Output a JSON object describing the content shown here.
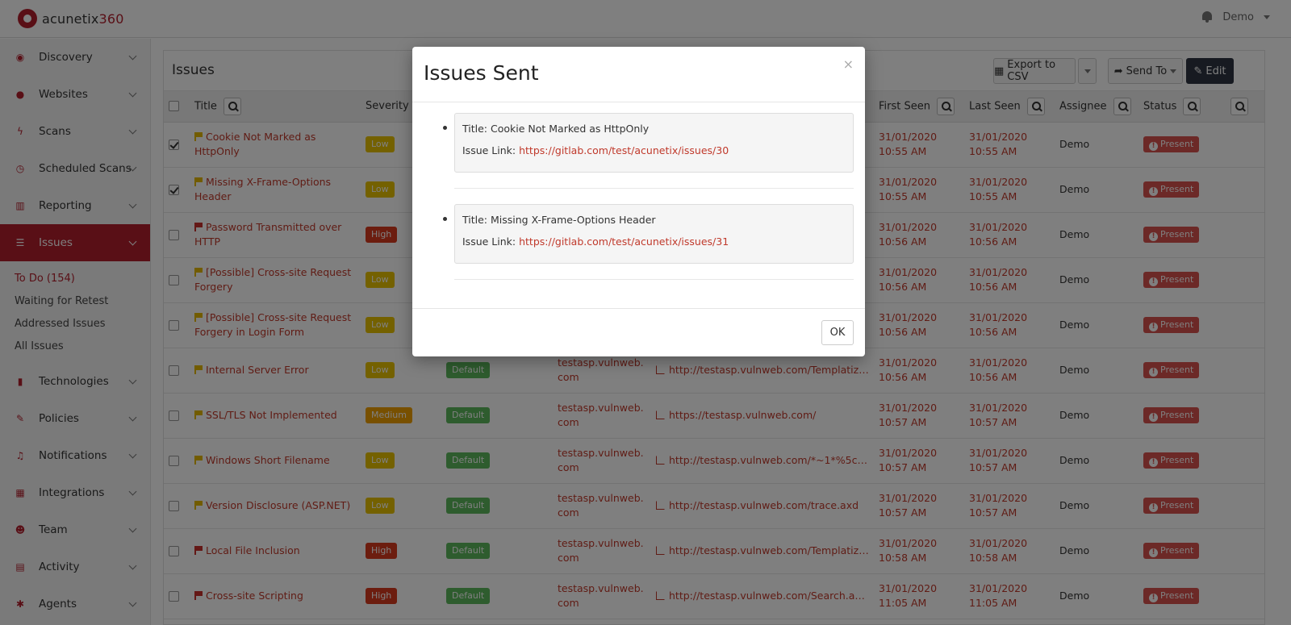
{
  "app": {
    "logo_prefix": "acunetix",
    "logo_suffix": "360",
    "user": "Demo"
  },
  "sidebar": {
    "items": [
      {
        "label": "Discovery",
        "icon": "discovery-icon",
        "glyph": "◉"
      },
      {
        "label": "Websites",
        "icon": "globe-icon",
        "glyph": "●"
      },
      {
        "label": "Scans",
        "icon": "bolt-icon",
        "glyph": "ϟ"
      },
      {
        "label": "Scheduled Scans",
        "icon": "clock-icon",
        "glyph": "◷"
      },
      {
        "label": "Reporting",
        "icon": "bar-chart-icon",
        "glyph": "▥"
      },
      {
        "label": "Issues",
        "icon": "list-icon",
        "glyph": "☰"
      },
      {
        "label": "Technologies",
        "icon": "book-icon",
        "glyph": "▮"
      },
      {
        "label": "Policies",
        "icon": "edit-icon",
        "glyph": "✎"
      },
      {
        "label": "Notifications",
        "icon": "bell-icon",
        "glyph": "♫"
      },
      {
        "label": "Integrations",
        "icon": "puzzle-icon",
        "glyph": "▦"
      },
      {
        "label": "Team",
        "icon": "users-icon",
        "glyph": "☻"
      },
      {
        "label": "Activity",
        "icon": "book-icon",
        "glyph": "▤"
      },
      {
        "label": "Agents",
        "icon": "asterisk-icon",
        "glyph": "✱"
      }
    ],
    "issues_sub": [
      "To Do (154)",
      "Waiting for Retest",
      "Addressed Issues",
      "All Issues"
    ]
  },
  "panel": {
    "title": "Issues",
    "export_label": "Export to CSV",
    "send_to_label": "Send To",
    "edit_label": "Edit"
  },
  "table": {
    "headers": {
      "title": "Title",
      "severity": "Severity",
      "first_seen": "First Seen",
      "last_seen": "Last Seen",
      "assignee": "Assignee",
      "status": "Status"
    },
    "rows": [
      {
        "checked": true,
        "flag": "yellow",
        "title": "Cookie Not Marked as HttpOnly",
        "severity": "Low",
        "sev_class": "low",
        "policy": "",
        "host": "",
        "url": "",
        "first_seen": "31/01/2020 10:55 AM",
        "last_seen": "31/01/2020 10:55 AM",
        "assignee": "Demo",
        "status": "Present"
      },
      {
        "checked": true,
        "flag": "yellow",
        "title": "Missing X-Frame-Options Header",
        "severity": "Low",
        "sev_class": "low",
        "policy": "",
        "host": "",
        "url": "",
        "first_seen": "31/01/2020 10:55 AM",
        "last_seen": "31/01/2020 10:55 AM",
        "assignee": "Demo",
        "status": "Present"
      },
      {
        "checked": false,
        "flag": "red",
        "title": "Password Transmitted over HTTP",
        "severity": "High",
        "sev_class": "high",
        "policy": "",
        "host": "",
        "url": "",
        "first_seen": "31/01/2020 10:56 AM",
        "last_seen": "31/01/2020 10:56 AM",
        "assignee": "Demo",
        "status": "Present"
      },
      {
        "checked": false,
        "flag": "yellow",
        "title": "[Possible] Cross-site Request Forgery",
        "severity": "Low",
        "sev_class": "low",
        "policy": "",
        "host": "",
        "url": "",
        "first_seen": "31/01/2020 10:56 AM",
        "last_seen": "31/01/2020 10:56 AM",
        "assignee": "Demo",
        "status": "Present"
      },
      {
        "checked": false,
        "flag": "yellow",
        "title": "[Possible] Cross-site Request Forgery in Login Form",
        "severity": "Low",
        "sev_class": "low",
        "policy": "",
        "host": "",
        "url": "",
        "first_seen": "31/01/2020 10:56 AM",
        "last_seen": "31/01/2020 10:56 AM",
        "assignee": "Demo",
        "status": "Present"
      },
      {
        "checked": false,
        "flag": "yellow",
        "title": "Internal Server Error",
        "severity": "Low",
        "sev_class": "low",
        "policy": "Default",
        "host": "testasp.vulnweb.com",
        "url": "http://testasp.vulnweb.com/Templatize.asp",
        "first_seen": "31/01/2020 10:56 AM",
        "last_seen": "31/01/2020 10:56 AM",
        "assignee": "Demo",
        "status": "Present"
      },
      {
        "checked": false,
        "flag": "yellow",
        "title": "SSL/TLS Not Implemented",
        "severity": "Medium",
        "sev_class": "medium",
        "policy": "Default",
        "host": "testasp.vulnweb.com",
        "url": "https://testasp.vulnweb.com/",
        "first_seen": "31/01/2020 10:57 AM",
        "last_seen": "31/01/2020 10:57 AM",
        "assignee": "Demo",
        "status": "Present"
      },
      {
        "checked": false,
        "flag": "yellow",
        "title": "Windows Short Filename",
        "severity": "Low",
        "sev_class": "low",
        "policy": "Default",
        "host": "testasp.vulnweb.com",
        "url": "http://testasp.vulnweb.com/*~1*%5ca.asp...",
        "first_seen": "31/01/2020 10:57 AM",
        "last_seen": "31/01/2020 10:57 AM",
        "assignee": "Demo",
        "status": "Present"
      },
      {
        "checked": false,
        "flag": "yellow",
        "title": "Version Disclosure (ASP.NET)",
        "severity": "Low",
        "sev_class": "low",
        "policy": "Default",
        "host": "testasp.vulnweb.com",
        "url": "http://testasp.vulnweb.com/trace.axd",
        "first_seen": "31/01/2020 10:57 AM",
        "last_seen": "31/01/2020 10:57 AM",
        "assignee": "Demo",
        "status": "Present"
      },
      {
        "checked": false,
        "flag": "red",
        "title": "Local File Inclusion",
        "severity": "High",
        "sev_class": "high",
        "policy": "Default",
        "host": "testasp.vulnweb.com",
        "url": "http://testasp.vulnweb.com/Templatize.as...",
        "first_seen": "31/01/2020 10:58 AM",
        "last_seen": "31/01/2020 10:58 AM",
        "assignee": "Demo",
        "status": "Present"
      },
      {
        "checked": false,
        "flag": "red",
        "title": "Cross-site Scripting",
        "severity": "High",
        "sev_class": "high",
        "policy": "Default",
        "host": "testasp.vulnweb.com",
        "url": "http://testasp.vulnweb.com/Search.asp?tf...",
        "first_seen": "31/01/2020 11:05 AM",
        "last_seen": "31/01/2020 11:05 AM",
        "assignee": "Demo",
        "status": "Present"
      }
    ]
  },
  "modal": {
    "title": "Issues Sent",
    "close": "×",
    "title_prefix": "Title:",
    "link_prefix": "Issue Link:",
    "items": [
      {
        "title": "Cookie Not Marked as HttpOnly",
        "link": "https://gitlab.com/test/acunetix/issues/30"
      },
      {
        "title": "Missing X-Frame-Options Header",
        "link": "https://gitlab.com/test/acunetix/issues/31"
      }
    ],
    "ok_label": "OK"
  }
}
